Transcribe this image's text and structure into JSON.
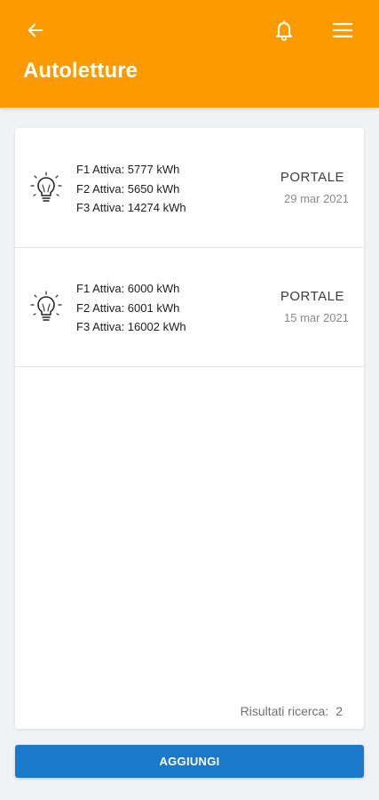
{
  "header": {
    "title": "Autoletture",
    "back_icon": "arrow-left-icon",
    "notification_icon": "bell-icon",
    "menu_icon": "hamburger-menu-icon",
    "background_color": "#fd9a00"
  },
  "readings": [
    {
      "icon": "lightbulb-icon",
      "lines": [
        "F1 Attiva: 5777 kWh",
        "F2 Attiva: 5650 kWh",
        "F3 Attiva: 14274 kWh"
      ],
      "source": "PORTALE",
      "date": "29 mar 2021"
    },
    {
      "icon": "lightbulb-icon",
      "lines": [
        "F1 Attiva: 6000 kWh",
        "F2 Attiva: 6001 kWh",
        "F3 Attiva: 16002 kWh"
      ],
      "source": "PORTALE",
      "date": "15 mar 2021"
    }
  ],
  "results": {
    "label": "Risultati ricerca:",
    "count": "2"
  },
  "add_button": {
    "label": "AGGIUNGI",
    "color": "#1b79cb"
  }
}
